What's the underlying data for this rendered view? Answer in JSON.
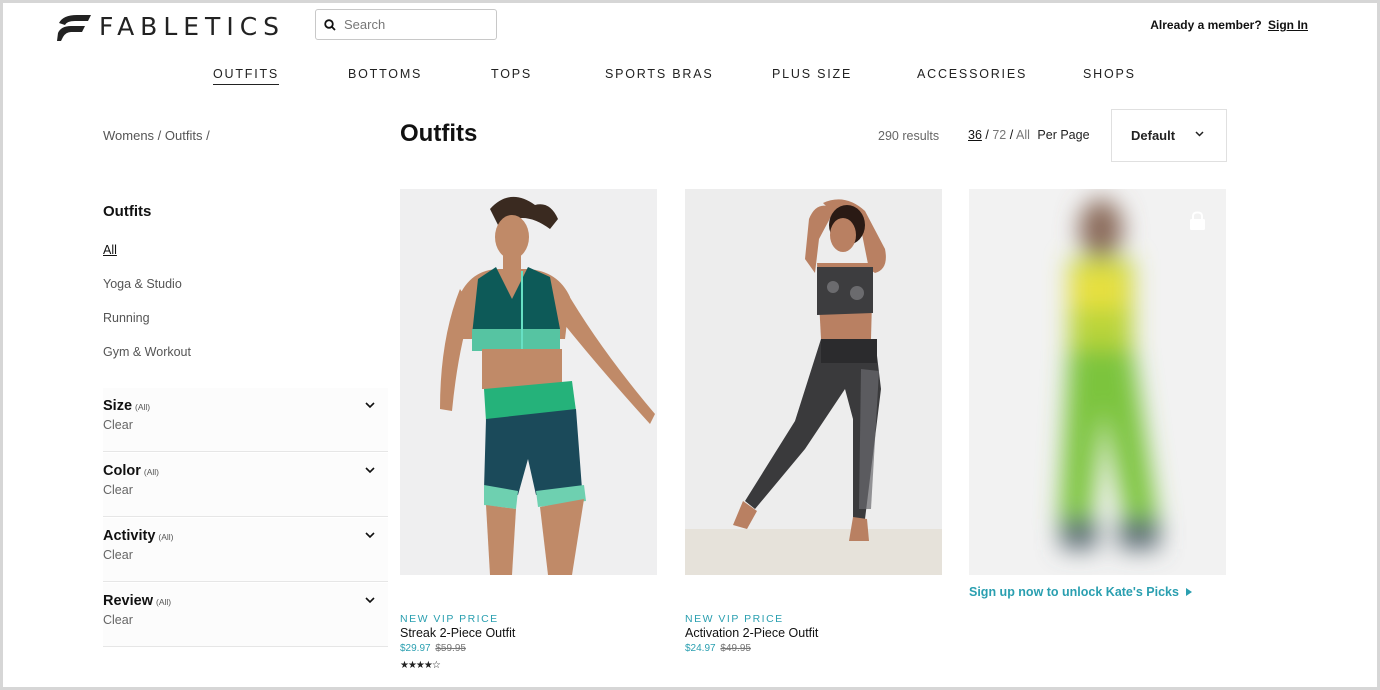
{
  "header": {
    "brand": "FABLETICS",
    "search_placeholder": "Search",
    "member_text": "Already a member?",
    "sign_in": "Sign In"
  },
  "nav": [
    "OUTFITS",
    "BOTTOMS",
    "TOPS",
    "SPORTS BRAS",
    "PLUS SIZE",
    "ACCESSORIES",
    "SHOPS"
  ],
  "breadcrumb": "Womens / Outfits /",
  "page_title": "Outfits",
  "results": "290 results",
  "per_page": {
    "opt1": "36",
    "opt2": "72",
    "opt3": "All",
    "label": "Per Page"
  },
  "sort": {
    "selected": "Default"
  },
  "sidebar": {
    "heading": "Outfits",
    "links": [
      "All",
      "Yoga & Studio",
      "Running",
      "Gym & Workout"
    ],
    "facets": [
      {
        "name": "Size",
        "scope": "(All)",
        "clear": "Clear"
      },
      {
        "name": "Color",
        "scope": "(All)",
        "clear": "Clear"
      },
      {
        "name": "Activity",
        "scope": "(All)",
        "clear": "Clear"
      },
      {
        "name": "Review",
        "scope": "(All)",
        "clear": "Clear"
      }
    ]
  },
  "products": [
    {
      "badge": "NEW VIP PRICE",
      "name": "Streak 2-Piece Outfit",
      "price": "$29.97",
      "original": "$59.95",
      "rating": "★★★★☆"
    },
    {
      "badge": "NEW VIP PRICE",
      "name": "Activation 2-Piece Outfit",
      "price": "$24.97",
      "original": "$49.95"
    }
  ],
  "locked_card": {
    "cta": "Sign up now to unlock Kate's Picks"
  },
  "colors": {
    "accent": "#2a9fb0",
    "text": "#111111"
  }
}
